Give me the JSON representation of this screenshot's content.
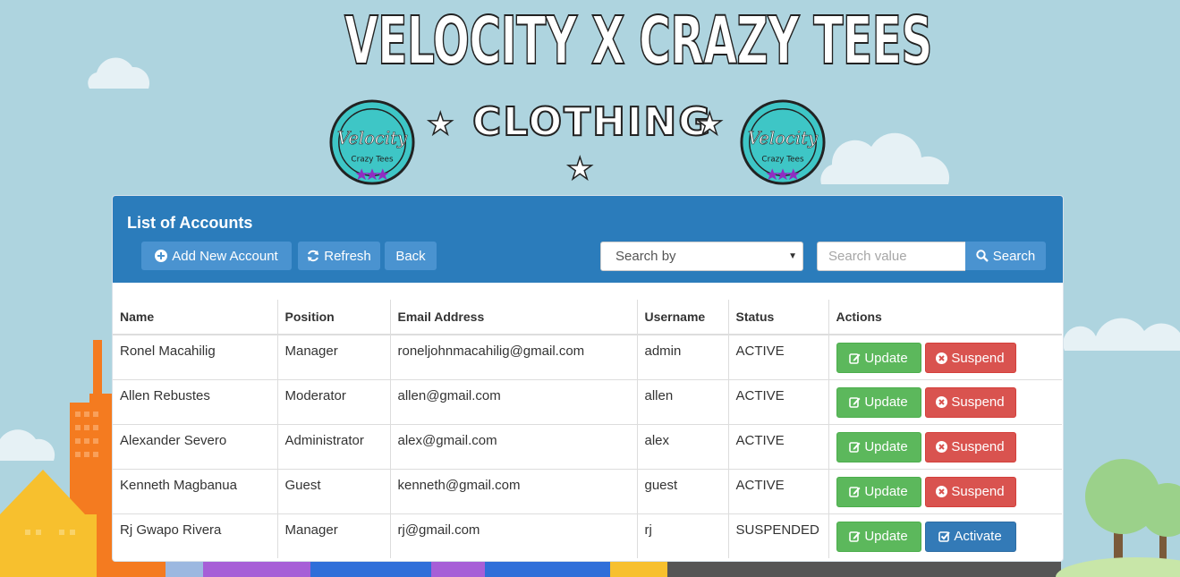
{
  "brand": {
    "title": "VELOCITY X CRAZY TEES",
    "subtitle": "CLOTHING",
    "badge_word": "Velocity",
    "badge_sub": "Crazy Tees",
    "badge_color": "#3ec6c6"
  },
  "panel": {
    "title": "List of Accounts",
    "add_label": "Add New Account",
    "refresh_label": "Refresh",
    "back_label": "Back",
    "search_by": "Search by",
    "search_placeholder": "Search value",
    "search_label": "Search",
    "accent": "#2b7cbb"
  },
  "table": {
    "headers": [
      "Name",
      "Position",
      "Email Address",
      "Username",
      "Status",
      "Actions"
    ],
    "rows": [
      {
        "name": "Ronel Macahilig",
        "position": "Manager",
        "email": "roneljohnmacahilig@gmail.com",
        "username": "admin",
        "status": "ACTIVE",
        "update": "Update",
        "toggle": "Suspend",
        "toggle_kind": "suspend"
      },
      {
        "name": "Allen Rebustes",
        "position": "Moderator",
        "email": "allen@gmail.com",
        "username": "allen",
        "status": "ACTIVE",
        "update": "Update",
        "toggle": "Suspend",
        "toggle_kind": "suspend"
      },
      {
        "name": "Alexander Severo",
        "position": "Administrator",
        "email": "alex@gmail.com",
        "username": "alex",
        "status": "ACTIVE",
        "update": "Update",
        "toggle": "Suspend",
        "toggle_kind": "suspend"
      },
      {
        "name": "Kenneth Magbanua",
        "position": "Guest",
        "email": "kenneth@gmail.com",
        "username": "guest",
        "status": "ACTIVE",
        "update": "Update",
        "toggle": "Suspend",
        "toggle_kind": "suspend"
      },
      {
        "name": "Rj Gwapo Rivera",
        "position": "Manager",
        "email": "rj@gmail.com",
        "username": "rj",
        "status": "SUSPENDED",
        "update": "Update",
        "toggle": "Activate",
        "toggle_kind": "activate"
      }
    ]
  },
  "icons": {
    "add": "plus-circle-icon",
    "refresh": "refresh-icon",
    "search": "search-icon",
    "update": "edit-icon",
    "suspend": "times-circle-icon",
    "activate": "check-square-icon"
  }
}
